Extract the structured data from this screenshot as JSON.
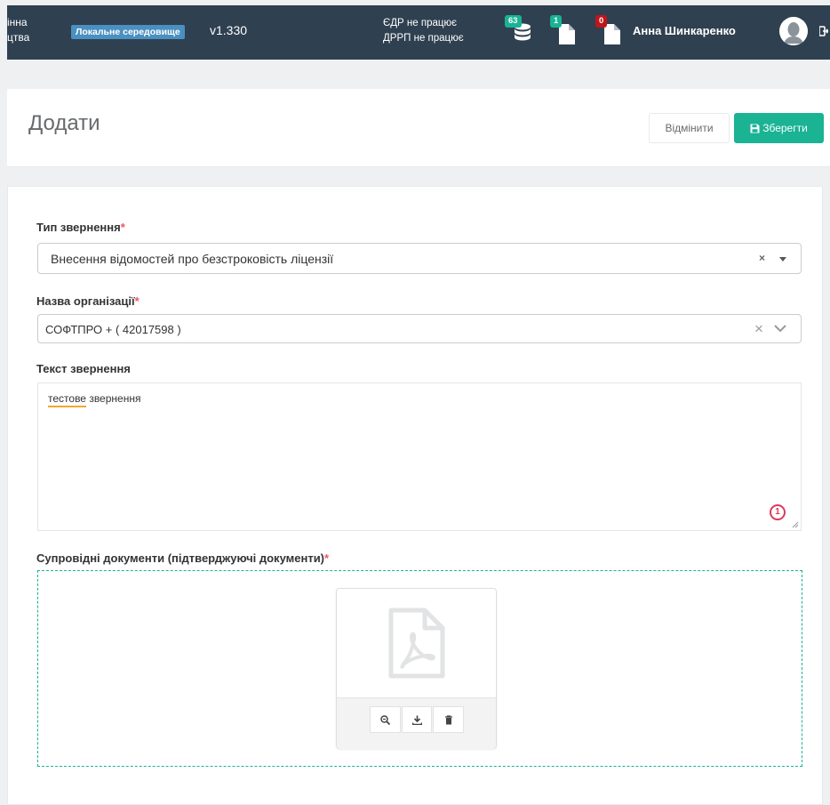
{
  "topbar": {
    "brand_line1": "інна",
    "brand_line2": "цтва",
    "environment": "Локальне середовище",
    "version": "v1.330",
    "status_edr": "ЄДР не працює",
    "status_drrp": "ДРРП не працює",
    "notifications": [
      {
        "icon": "database-icon",
        "count": "63",
        "color": "#1ab394"
      },
      {
        "icon": "file-icon",
        "count": "1",
        "color": "#1ab394"
      },
      {
        "icon": "file-icon",
        "count": "0",
        "color": "#c0151b"
      }
    ],
    "user_name": "Анна Шинкаренко"
  },
  "page": {
    "title": "Додати",
    "cancel_label": "Відмінити",
    "save_label": "Зберегти",
    "save_icon": "floppy-icon"
  },
  "form": {
    "request_type": {
      "label": "Тип звернення",
      "required_mark": "*",
      "value": "Внесення відомостей про безстроковість ліцензії",
      "clear": "×"
    },
    "organization": {
      "label": "Назва організації",
      "required_mark": "*",
      "value": "СОФТПРО + ( 42017598 )",
      "clear": "×"
    },
    "request_text": {
      "label": "Текст звернення",
      "value_word1": "тестове",
      "value_rest": " звернення",
      "counter": "1"
    },
    "documents": {
      "label": "Супровідні документи (підтверджуючі документи)",
      "required_mark": "*",
      "file_type_icon": "pdf-icon",
      "actions": [
        "zoom-icon",
        "download-icon",
        "delete-icon"
      ]
    }
  },
  "colors": {
    "topbar_bg": "#2f4050",
    "accent_green": "#1ab394",
    "env_badge": "#4a90c0",
    "required": "#ed5565"
  }
}
